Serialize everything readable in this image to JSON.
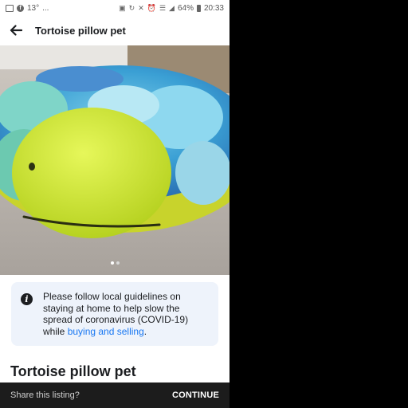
{
  "status_bar": {
    "temperature": "13°",
    "signal_dots": "...",
    "battery": "64%",
    "time": "20:33",
    "icons": [
      "gallery-icon",
      "facebook-icon",
      "lock-icon",
      "sync-icon",
      "mute-icon",
      "alarm-icon",
      "wifi-icon",
      "signal-icon",
      "battery-icon"
    ]
  },
  "header": {
    "title": "Tortoise pillow pet",
    "back_icon": "arrow-left-icon"
  },
  "photo": {
    "image_count": 2,
    "active_index": 0
  },
  "notice": {
    "icon": "info-icon",
    "text_before": "Please follow local guidelines on staying at home to help slow the spread of coronavirus (COVID-19) while ",
    "link_text": "buying and selling",
    "text_after": ".",
    "link_color": "#1877f2",
    "background": "#eef3fb"
  },
  "listing": {
    "title": "Tortoise pillow pet"
  },
  "bottom_bar": {
    "prompt": "Share this listing?",
    "action": "CONTINUE"
  }
}
